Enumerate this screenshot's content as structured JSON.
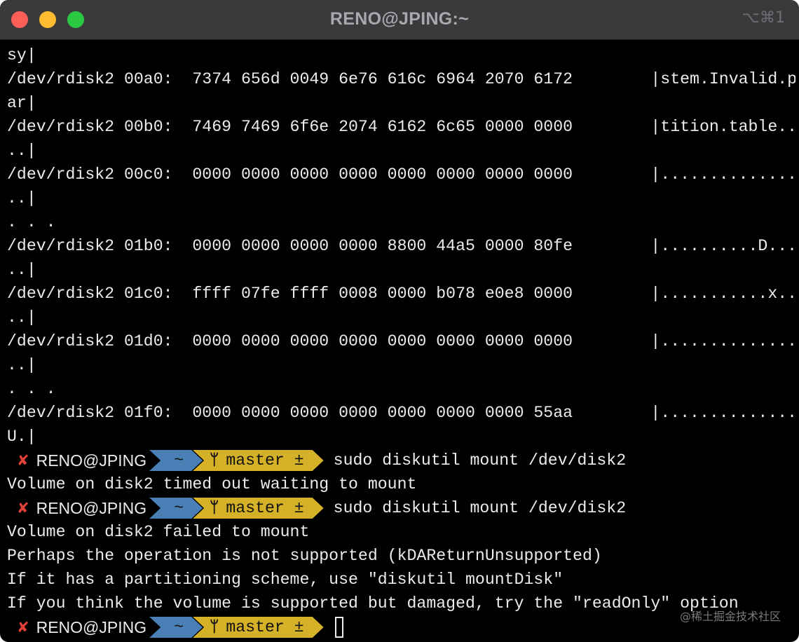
{
  "window": {
    "title": "RENO@JPING:~",
    "shortcut": "⌥⌘1"
  },
  "terminal": {
    "lines": [
      "sy|",
      "/dev/rdisk2 00a0:  7374 656d 0049 6e76 616c 6964 2070 6172        |stem.Invalid.p",
      "ar|",
      "/dev/rdisk2 00b0:  7469 7469 6f6e 2074 6162 6c65 0000 0000        |tition.table..",
      "..|",
      "/dev/rdisk2 00c0:  0000 0000 0000 0000 0000 0000 0000 0000        |..............",
      "..|",
      ". . .",
      "/dev/rdisk2 01b0:  0000 0000 0000 0000 8800 44a5 0000 80fe        |..........D...",
      "..|",
      "/dev/rdisk2 01c0:  ffff 07fe ffff 0008 0000 b078 e0e8 0000        |...........x..",
      "..|",
      "/dev/rdisk2 01d0:  0000 0000 0000 0000 0000 0000 0000 0000        |..............",
      "..|",
      ". . .",
      "/dev/rdisk2 01f0:  0000 0000 0000 0000 0000 0000 0000 55aa        |..............",
      "U.|"
    ],
    "prompt": {
      "status_icon": "✘",
      "user_host": "RENO@JPING",
      "dir": "~",
      "branch_icon": "ᛘ",
      "branch": "master ±"
    },
    "command_1": "sudo diskutil mount /dev/disk2",
    "output_1": [
      "Volume on disk2 timed out waiting to mount"
    ],
    "command_2": "sudo diskutil mount /dev/disk2",
    "output_2": [
      "Volume on disk2 failed to mount",
      "Perhaps the operation is not supported (kDAReturnUnsupported)",
      "If it has a partitioning scheme, use \"diskutil mountDisk\"",
      "If you think the volume is supported but damaged, try the \"readOnly\" option"
    ]
  },
  "watermark": "@稀土掘金技术社区",
  "colors": {
    "background": "#000000",
    "titlebar": "#3a3a3c",
    "text": "#ececec",
    "error_x": "#e2413a",
    "dir_segment": "#4a7fb5",
    "git_segment": "#d4b126"
  }
}
